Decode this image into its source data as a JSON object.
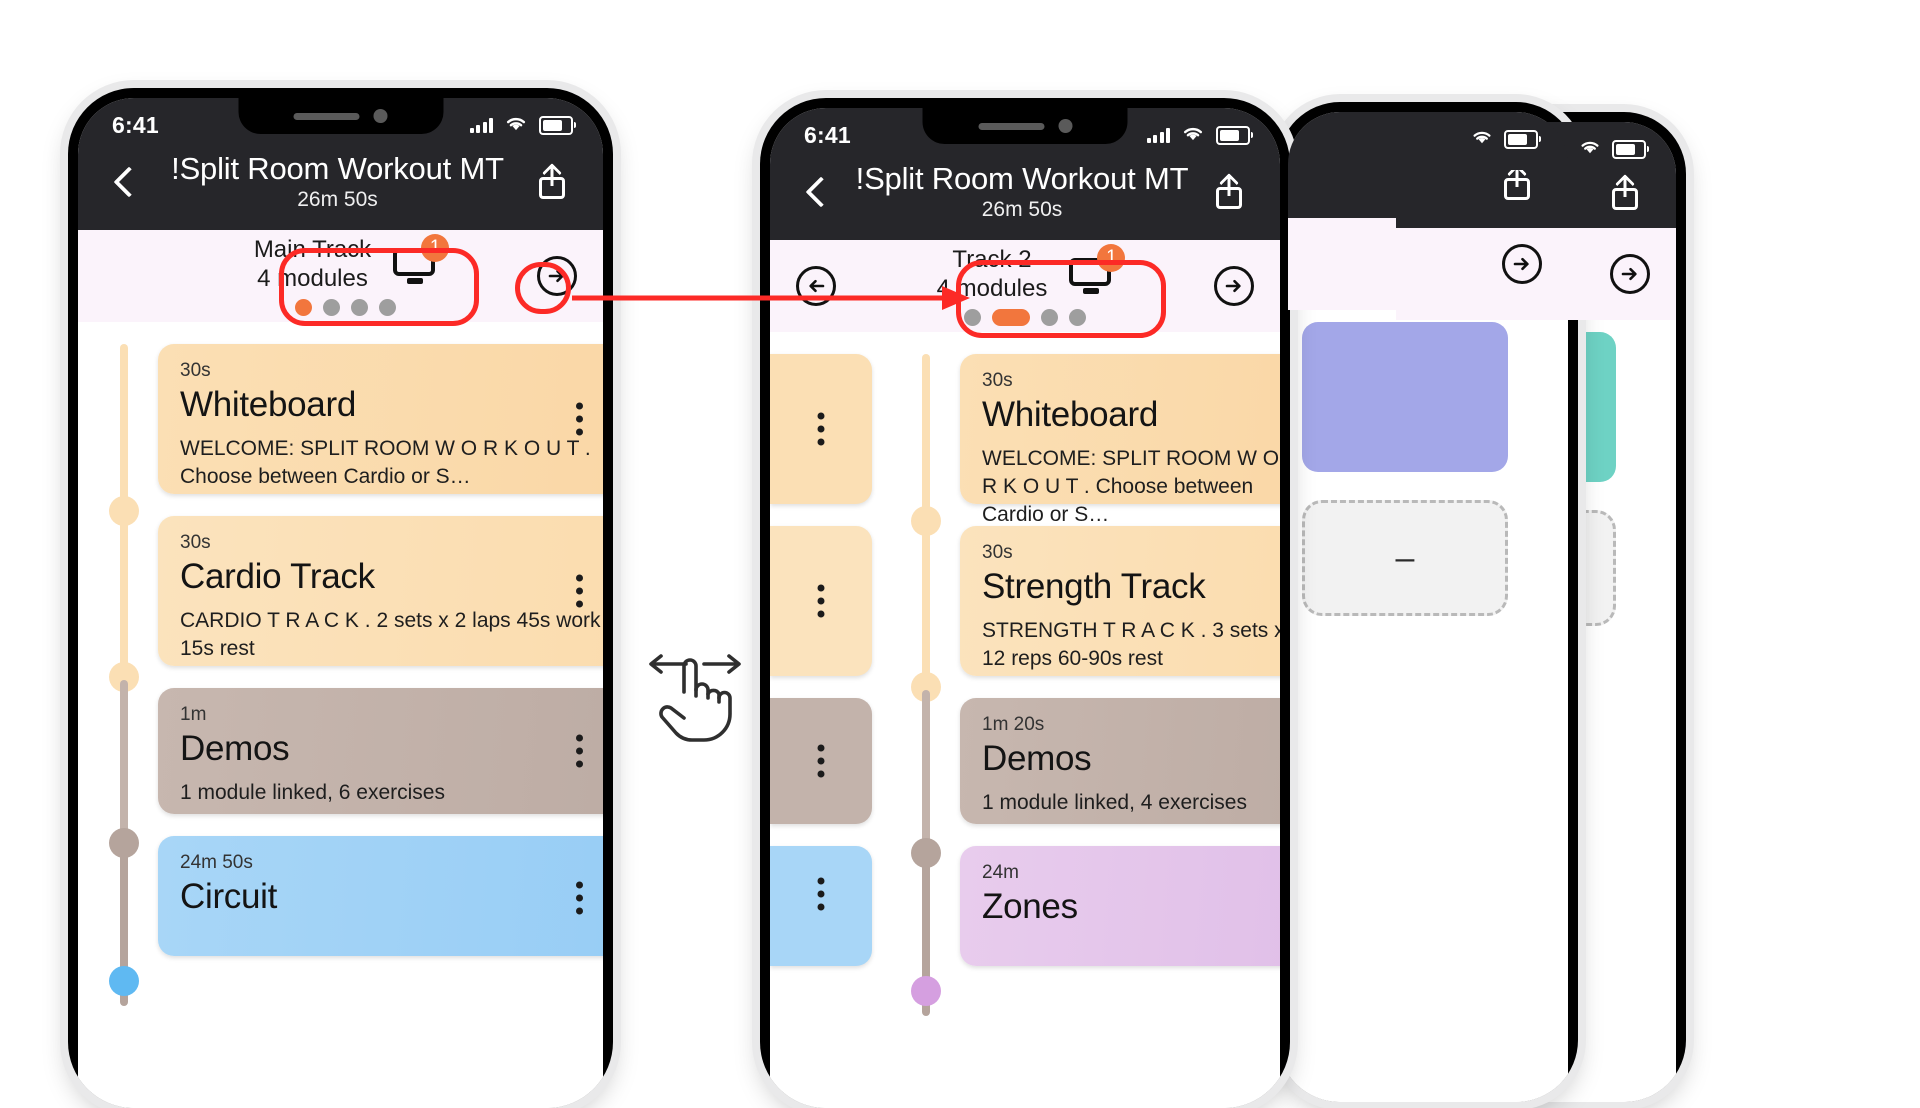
{
  "app": {
    "status_bar": {
      "time": "6:41",
      "wifi_icon": "wifi-icon",
      "cellular_icon": "cellular-bars-icon",
      "battery_icon": "battery-icon"
    },
    "nav": {
      "back_icon": "chevron-left-icon",
      "title": "!Split Room Workout MT",
      "subtitle": "26m 50s",
      "share_icon": "share-icon"
    }
  },
  "phone1": {
    "track": {
      "name": "Main Track",
      "modules": "4 modules",
      "monitor_icon": "monitor-icon",
      "badge": "1",
      "dots": [
        "active",
        "idle",
        "idle",
        "idle"
      ]
    },
    "next_icon": "arrow-right-circle-icon",
    "modules": [
      {
        "duration": "30s",
        "title": "Whiteboard",
        "desc": "WELCOME: SPLIT ROOM W O R K O U T . Choose between Cardio or S…",
        "color": "#fbdfb4",
        "node": "#fbdfb4",
        "menu_icon": "kebab-menu-icon"
      },
      {
        "duration": "30s",
        "title": "Cardio Track",
        "desc": "CARDIO T R A C K .  2 sets x 2 laps 45s work 15s rest",
        "color": "#fbe3bd",
        "node": "#fbdfb4",
        "menu_icon": "kebab-menu-icon"
      },
      {
        "duration": "1m",
        "title": "Demos",
        "desc": "1 module linked, 6 exercises",
        "color": "#c3b3ab",
        "node": "#b5a49c",
        "menu_icon": "kebab-menu-icon"
      },
      {
        "duration": "24m 50s",
        "title": "Circuit",
        "desc": "",
        "color": "#a8d6f7",
        "node": "#5fb9f2",
        "menu_icon": "kebab-menu-icon"
      }
    ]
  },
  "phone2": {
    "prev_icon": "arrow-left-circle-icon",
    "next_icon": "arrow-right-circle-icon",
    "track": {
      "name": "Track 2",
      "modules": "4 modules",
      "monitor_icon": "monitor-icon",
      "badge": "1",
      "dots": [
        "idle",
        "active",
        "idle",
        "idle"
      ]
    },
    "modules": [
      {
        "duration": "30s",
        "title": "Whiteboard",
        "desc": "WELCOME: SPLIT ROOM W O R K O U T . Choose between Cardio or S…",
        "color": "#fbdfb4",
        "node": "#fbdfb4",
        "menu_icon": "kebab-menu-icon"
      },
      {
        "duration": "30s",
        "title": "Strength Track",
        "desc": "STRENGTH T R A C K .  3 sets x 12 reps 60-90s rest",
        "color": "#fbe3bd",
        "node": "#fbdfb4",
        "menu_icon": "kebab-menu-icon"
      },
      {
        "duration": "1m 20s",
        "title": "Demos",
        "desc": "1 module linked, 4 exercises",
        "color": "#c3b3ab",
        "node": "#b5a49c",
        "menu_icon": "kebab-menu-icon"
      },
      {
        "duration": "24m",
        "title": "Zones",
        "desc": "",
        "color": "#e4c6ea",
        "node": "#d59fe0",
        "menu_icon": "kebab-menu-icon"
      }
    ],
    "peek_cards": [
      {
        "color": "#fbdfb4",
        "menu_icon": "kebab-menu-icon"
      },
      {
        "color": "#fbe3bd",
        "menu_icon": "kebab-menu-icon"
      },
      {
        "color": "#c3b3ab",
        "menu_icon": "kebab-menu-icon"
      },
      {
        "color": "#a8d6f7",
        "menu_icon": "kebab-menu-icon"
      }
    ]
  },
  "phone3": {
    "next_icon": "arrow-right-circle-icon",
    "share_icon": "share-icon",
    "card_color": "#a3a7e8",
    "placeholder_glyph": "–"
  },
  "phone4": {
    "next_icon": "arrow-right-circle-icon",
    "share_icon": "share-icon",
    "card_color": "#6ed2c4",
    "placeholder_glyph": "+"
  },
  "annotations": {
    "highlight_color": "#fc2a26",
    "connector_label": "arrow-from-next-button-to-track2-pill",
    "gesture_icon": "swipe-horizontal-hand-icon"
  }
}
